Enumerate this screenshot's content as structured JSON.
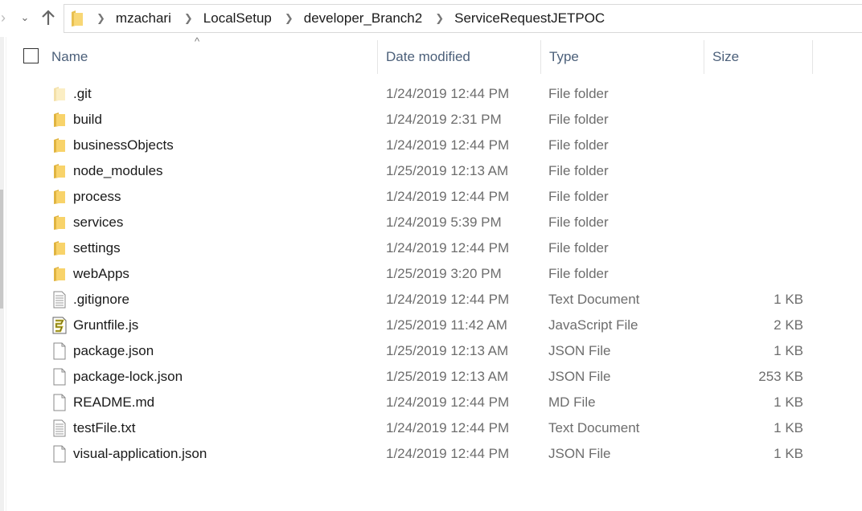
{
  "address_bar": {
    "crumbs": [
      "mzachari",
      "LocalSetup",
      "developer_Branch2",
      "ServiceRequestJETPOC"
    ]
  },
  "columns": {
    "name": "Name",
    "date": "Date modified",
    "type": "Type",
    "size": "Size"
  },
  "files": [
    {
      "name": ".git",
      "date": "1/24/2019 12:44 PM",
      "type": "File folder",
      "size": "",
      "icon": "folder-hidden"
    },
    {
      "name": "build",
      "date": "1/24/2019 2:31 PM",
      "type": "File folder",
      "size": "",
      "icon": "folder"
    },
    {
      "name": "businessObjects",
      "date": "1/24/2019 12:44 PM",
      "type": "File folder",
      "size": "",
      "icon": "folder"
    },
    {
      "name": "node_modules",
      "date": "1/25/2019 12:13 AM",
      "type": "File folder",
      "size": "",
      "icon": "folder"
    },
    {
      "name": "process",
      "date": "1/24/2019 12:44 PM",
      "type": "File folder",
      "size": "",
      "icon": "folder"
    },
    {
      "name": "services",
      "date": "1/24/2019 5:39 PM",
      "type": "File folder",
      "size": "",
      "icon": "folder"
    },
    {
      "name": "settings",
      "date": "1/24/2019 12:44 PM",
      "type": "File folder",
      "size": "",
      "icon": "folder"
    },
    {
      "name": "webApps",
      "date": "1/25/2019 3:20 PM",
      "type": "File folder",
      "size": "",
      "icon": "folder"
    },
    {
      "name": ".gitignore",
      "date": "1/24/2019 12:44 PM",
      "type": "Text Document",
      "size": "1 KB",
      "icon": "text-file"
    },
    {
      "name": "Gruntfile.js",
      "date": "1/25/2019 11:42 AM",
      "type": "JavaScript File",
      "size": "2 KB",
      "icon": "script-file"
    },
    {
      "name": "package.json",
      "date": "1/25/2019 12:13 AM",
      "type": "JSON File",
      "size": "1 KB",
      "icon": "file"
    },
    {
      "name": "package-lock.json",
      "date": "1/25/2019 12:13 AM",
      "type": "JSON File",
      "size": "253 KB",
      "icon": "file"
    },
    {
      "name": "README.md",
      "date": "1/24/2019 12:44 PM",
      "type": "MD File",
      "size": "1 KB",
      "icon": "file"
    },
    {
      "name": "testFile.txt",
      "date": "1/24/2019 12:44 PM",
      "type": "Text Document",
      "size": "1 KB",
      "icon": "text-file"
    },
    {
      "name": "visual-application.json",
      "date": "1/24/2019 12:44 PM",
      "type": "JSON File",
      "size": "1 KB",
      "icon": "file"
    }
  ]
}
